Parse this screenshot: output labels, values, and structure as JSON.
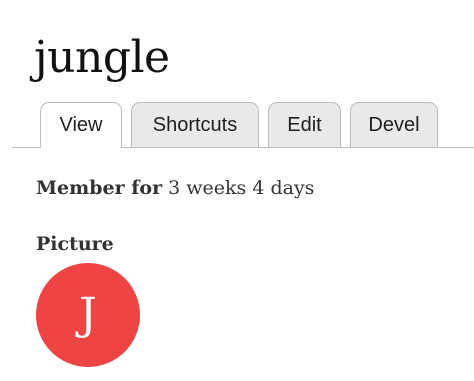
{
  "page": {
    "title": "jungle"
  },
  "tabs": [
    {
      "label": "View",
      "active": true
    },
    {
      "label": "Shortcuts",
      "active": false
    },
    {
      "label": "Edit",
      "active": false
    },
    {
      "label": "Devel",
      "active": false
    }
  ],
  "profile": {
    "member_label": "Member for",
    "member_value": "3 weeks 4 days",
    "picture_label": "Picture",
    "avatar_initial": "J",
    "avatar_color": "#ef4444"
  }
}
